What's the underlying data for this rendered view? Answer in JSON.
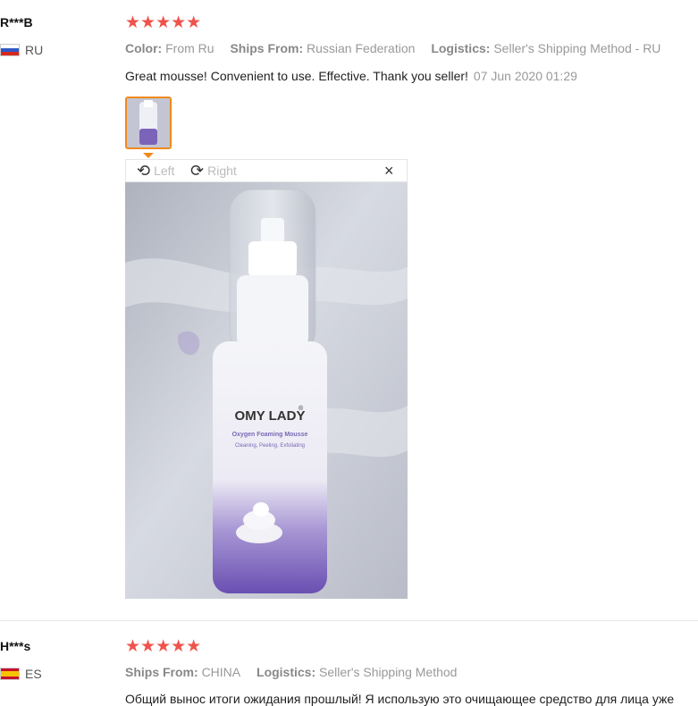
{
  "reviews": [
    {
      "author": "R***B",
      "country": "RU",
      "stars": "★★★★★",
      "rating": 5,
      "meta": [
        {
          "key": "Color:",
          "value": "From Ru"
        },
        {
          "key": "Ships From:",
          "value": "Russian Federation"
        },
        {
          "key": "Logistics:",
          "value": "Seller's Shipping Method - RU"
        }
      ],
      "text": "Great mousse! Convenient to use. Effective. Thank you seller!",
      "date": "07 Jun 2020 01:29",
      "viewer": {
        "rotate_left_label": "Left",
        "rotate_right_label": "Right",
        "close_symbol": "×",
        "rotate_left_icon": "rotate-left-icon",
        "rotate_right_icon": "rotate-right-icon"
      },
      "product": {
        "brand": "OMY LADY",
        "registered": "®",
        "name": "Oxygen Foaming Mousse",
        "tagline": "Cleaning, Peeling, Exfoliating"
      }
    },
    {
      "author": "H***s",
      "country": "ES",
      "stars": "★★★★★",
      "rating": 5,
      "meta": [
        {
          "key": "Ships From:",
          "value": "CHINA"
        },
        {
          "key": "Logistics:",
          "value": "Seller's Shipping Method"
        }
      ],
      "text": "Общий вынос итоги ожидания прошлый! Я использую это очищающее средство для лица уже"
    }
  ],
  "colors": {
    "star": "#f0534c",
    "thumb_border": "#f08a1e",
    "meta_text": "#999999"
  }
}
